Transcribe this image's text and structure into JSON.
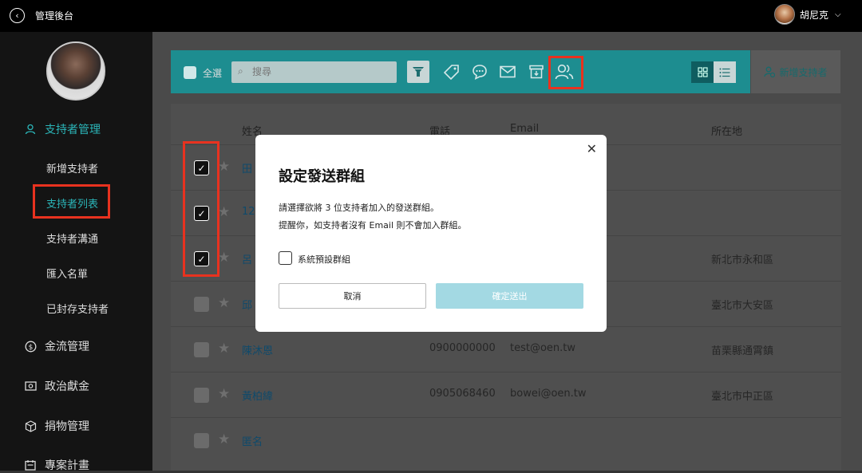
{
  "header": {
    "back_icon": "chevron-left-circle-icon",
    "app_title": "管理後台",
    "user_name": "胡尼克",
    "dropdown_icon": "chevron-down-icon"
  },
  "sidebar": {
    "sections": [
      {
        "label": "支持者管理",
        "icon": "user-icon"
      },
      {
        "label": "金流管理",
        "icon": "dollar-icon"
      },
      {
        "label": "政治獻金",
        "icon": "cash-icon"
      },
      {
        "label": "捐物管理",
        "icon": "box-icon"
      },
      {
        "label": "專案計畫",
        "icon": "calendar-icon"
      }
    ],
    "subitems": [
      "新增支持者",
      "支持者列表",
      "支持者溝通",
      "匯入名單",
      "已封存支持者"
    ]
  },
  "toolbar": {
    "select_all": "全選",
    "search_placeholder": "搜尋",
    "add_supporter": "新增支持者"
  },
  "table": {
    "columns": [
      "姓名",
      "電話",
      "Email",
      "所在地"
    ],
    "rows": [
      {
        "name": "田",
        "phone": "",
        "email": "",
        "location": "",
        "checked": true
      },
      {
        "name": "12",
        "phone": "",
        "email": "",
        "location": "",
        "checked": true
      },
      {
        "name": "呂",
        "phone": "",
        "email": "",
        "location": "新北市永和區",
        "checked": true
      },
      {
        "name": "邱",
        "phone": "",
        "email": "",
        "location": "臺北市大安區",
        "checked": false
      },
      {
        "name": "陳沐恩",
        "phone": "0900000000",
        "email": "test@oen.tw",
        "location": "苗栗縣通霄鎮",
        "checked": false
      },
      {
        "name": "黃柏緯",
        "phone": "0905068460",
        "email": "bowei@oen.tw",
        "location": "臺北市中正區",
        "checked": false
      },
      {
        "name": "匿名",
        "phone": "",
        "email": "",
        "location": "",
        "checked": false
      }
    ]
  },
  "modal": {
    "title": "設定發送群組",
    "line1": "請選擇欲將 3 位支持者加入的發送群組。",
    "line2": "提醒你，如支持者沒有 Email 則不會加入群組。",
    "option_label": "系統預設群組",
    "cancel": "取消",
    "submit": "確定送出"
  },
  "colors": {
    "accent": "#2bb5b8",
    "highlight": "#e8321f",
    "submit_button": "#a3d9e3"
  }
}
